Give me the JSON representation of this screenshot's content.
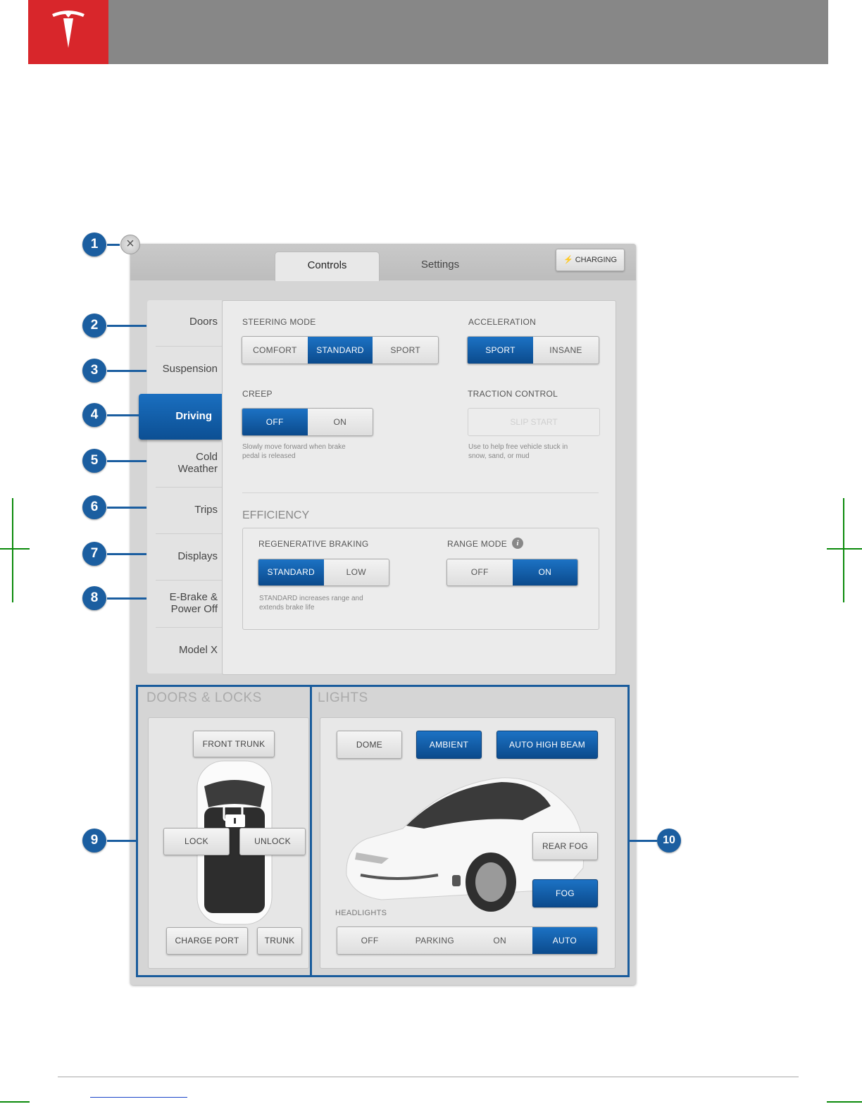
{
  "tabs": {
    "controls": "Controls",
    "settings": "Settings"
  },
  "charging_label": "⚡ CHARGING",
  "close_glyph": "×",
  "sidenav": {
    "doors": "Doors",
    "suspension": "Suspension",
    "driving": "Driving",
    "cold_weather_1": "Cold",
    "cold_weather_2": "Weather",
    "trips": "Trips",
    "displays": "Displays",
    "ebrake_1": "E-Brake &",
    "ebrake_2": "Power Off",
    "modelx": "Model X"
  },
  "steering": {
    "label": "STEERING MODE",
    "options": [
      "COMFORT",
      "STANDARD",
      "SPORT"
    ],
    "selected": "STANDARD"
  },
  "acceleration": {
    "label": "ACCELERATION",
    "options": [
      "SPORT",
      "INSANE"
    ],
    "selected": "SPORT"
  },
  "creep": {
    "label": "CREEP",
    "options": [
      "OFF",
      "ON"
    ],
    "selected": "OFF",
    "hint_1": "Slowly move forward when brake",
    "hint_2": "pedal is released"
  },
  "traction": {
    "label": "TRACTION CONTROL",
    "button": "SLIP START",
    "hint_1": "Use to help free vehicle stuck in",
    "hint_2": "snow, sand, or mud"
  },
  "efficiency": {
    "title": "EFFICIENCY",
    "regen": {
      "label": "REGENERATIVE BRAKING",
      "options": [
        "STANDARD",
        "LOW"
      ],
      "selected": "STANDARD",
      "hint_1": "STANDARD increases range and",
      "hint_2": "extends brake life"
    },
    "range": {
      "label": "RANGE MODE",
      "info": "i",
      "options": [
        "OFF",
        "ON"
      ],
      "selected": "ON"
    }
  },
  "doors_locks": {
    "title": "DOORS & LOCKS",
    "front_trunk": "FRONT TRUNK",
    "lock": "LOCK",
    "unlock": "UNLOCK",
    "charge_port": "CHARGE PORT",
    "trunk": "TRUNK"
  },
  "lights": {
    "title": "LIGHTS",
    "dome": "DOME",
    "ambient": "AMBIENT",
    "auto_high_beam": "AUTO HIGH BEAM",
    "rear_fog": "REAR FOG",
    "fog": "FOG",
    "headlights_label": "HEADLIGHTS",
    "headlights_options": [
      "OFF",
      "PARKING",
      "ON",
      "AUTO"
    ],
    "headlights_selected": "AUTO"
  },
  "callouts": [
    "1",
    "2",
    "3",
    "4",
    "5",
    "6",
    "7",
    "8",
    "9",
    "10"
  ],
  "colors": {
    "brand_red": "#d8262b",
    "accent_blue": "#0b4a8c",
    "callout_blue": "#1b5ea0",
    "header_gray": "#878787"
  }
}
